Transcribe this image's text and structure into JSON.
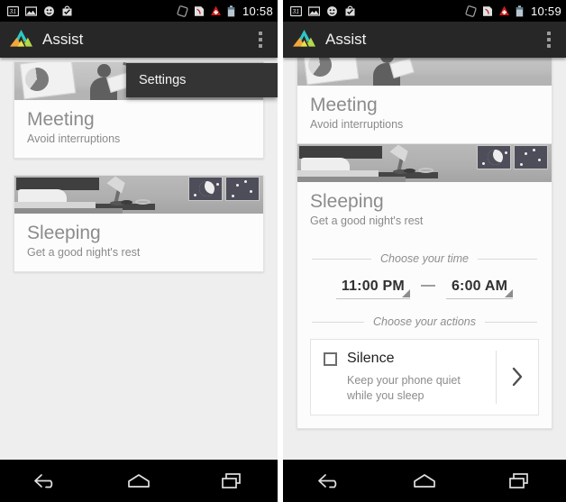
{
  "app": {
    "title": "Assist",
    "logo_icon": "assist-triangle-logo",
    "overflow_icon": "overflow-menu-icon",
    "accent_teal": "#35c4c4",
    "accent_orange": "#f2a63b",
    "accent_green": "#a8d64a"
  },
  "screens": [
    {
      "id": "left",
      "statusbar": {
        "time": "10:58",
        "left_icons": [
          "calendar-31-icon",
          "photo-icon",
          "smiley-face-icon",
          "checklist-bag-icon"
        ],
        "right_icons": [
          "rotation-lock-icon",
          "sim-card-icon",
          "swiss-cross-icon",
          "battery-icon"
        ]
      },
      "popup_menu": {
        "visible": true,
        "items": [
          "Settings"
        ]
      },
      "cards": [
        {
          "title": "Meeting",
          "subtitle": "Avoid interruptions",
          "hero": "office-meeting-illustration"
        },
        {
          "title": "Sleeping",
          "subtitle": "Get a good night's rest",
          "hero": "bedroom-night-illustration"
        }
      ]
    },
    {
      "id": "right",
      "statusbar": {
        "time": "10:59",
        "left_icons": [
          "calendar-31-icon",
          "photo-icon",
          "smiley-face-icon",
          "checklist-bag-icon"
        ],
        "right_icons": [
          "rotation-lock-icon",
          "sim-card-icon",
          "swiss-cross-icon",
          "battery-icon"
        ]
      },
      "popup_menu": {
        "visible": false,
        "items": []
      },
      "cards": [
        {
          "title": "Meeting",
          "subtitle": "Avoid interruptions",
          "hero": "office-meeting-illustration"
        },
        {
          "title": "Sleeping",
          "subtitle": "Get a good night's rest",
          "hero": "bedroom-night-illustration"
        }
      ],
      "detail": {
        "time_section_label": "Choose your time",
        "start_time": "11:00 PM",
        "separator": "—",
        "end_time": "6:00 AM",
        "actions_section_label": "Choose your actions",
        "action": {
          "label": "Silence",
          "description": "Keep your phone quiet while you sleep",
          "checked": false,
          "chevron_icon": "chevron-right-icon"
        }
      }
    }
  ],
  "navbar": {
    "back_icon": "back-arrow-icon",
    "home_icon": "home-icon",
    "recents_icon": "recent-apps-icon"
  }
}
